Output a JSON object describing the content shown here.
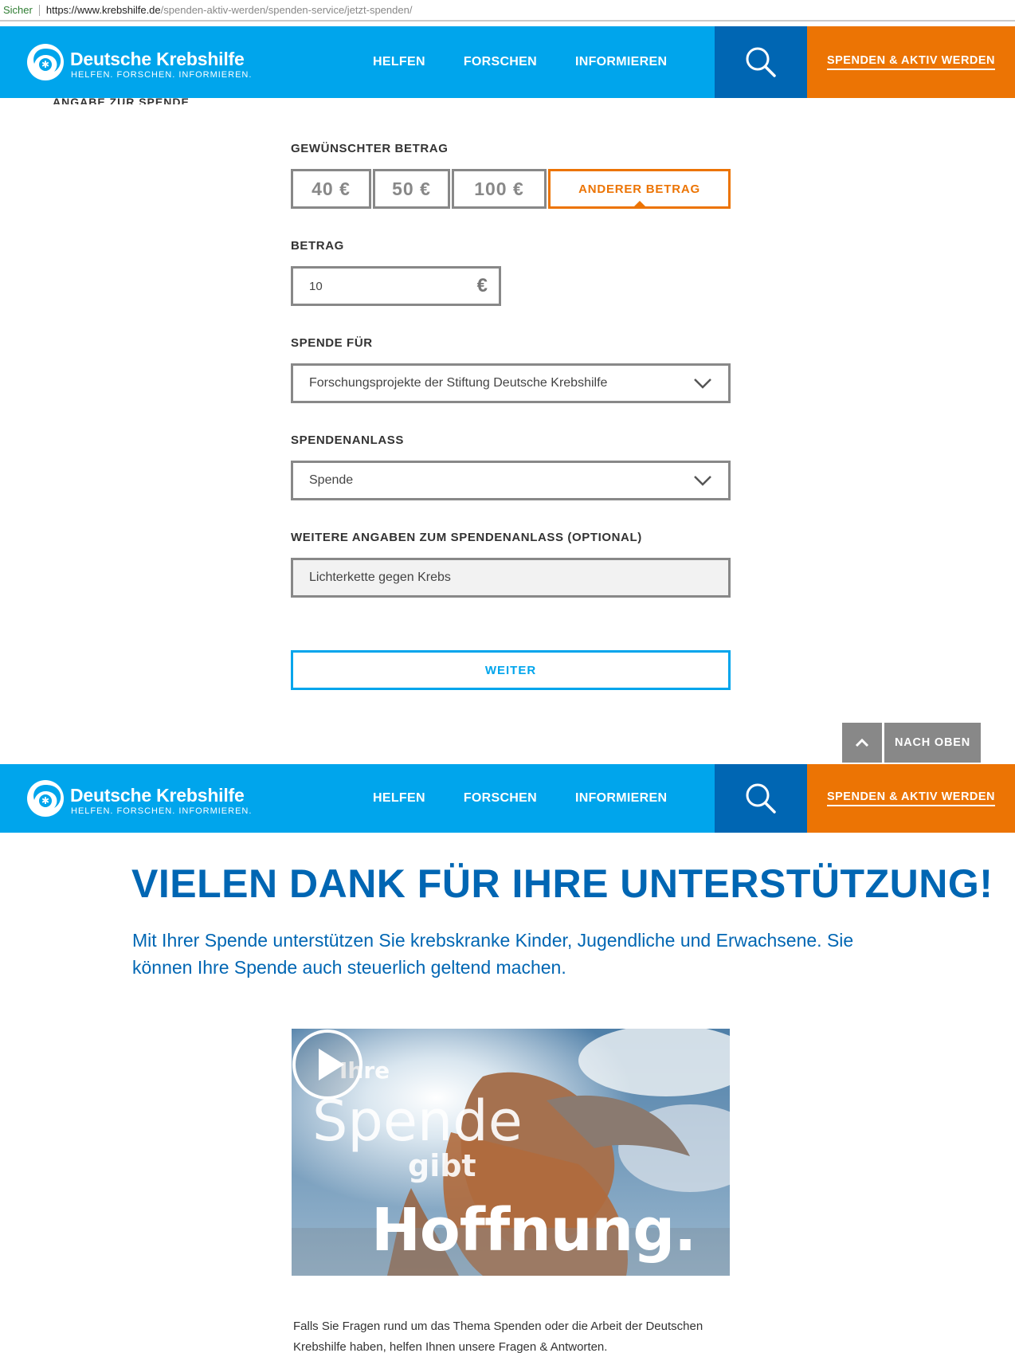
{
  "browser": {
    "secure_label": "Sicher",
    "url_host": "https://www.krebshilfe.de",
    "url_path": "/spenden-aktiv-werden/spenden-service/jetzt-spenden/"
  },
  "header": {
    "logo_name": "Deutsche Krebshilfe",
    "logo_tagline": "HELFEN. FORSCHEN. INFORMIEREN.",
    "nav": [
      "HELFEN",
      "FORSCHEN",
      "INFORMIEREN"
    ],
    "cta": "SPENDEN & AKTIV WERDEN",
    "colors": {
      "header": "#00a5ec",
      "search": "#0066b3",
      "cta": "#ec7404"
    }
  },
  "form": {
    "section_heading": "ANGABE ZUR SPENDE",
    "amount_label": "GEWÜNSCHTER BETRAG",
    "amounts": [
      "40 €",
      "50 €",
      "100 €",
      "ANDERER BETRAG"
    ],
    "selected_amount": "ANDERER BETRAG",
    "betrag_label": "BETRAG",
    "betrag_value": "10",
    "currency": "€",
    "purpose_label": "SPENDE FÜR",
    "purpose_value": "Forschungsprojekte der Stiftung Deutsche Krebshilfe",
    "occasion_label": "SPENDENANLASS",
    "occasion_value": "Spende",
    "extra_label": "WEITERE ANGABEN ZUM SPENDENANLASS (OPTIONAL)",
    "extra_value": "Lichterkette gegen Krebs",
    "submit": "WEITER"
  },
  "back_to_top": "NACH OBEN",
  "thanks": {
    "title": "VIELEN DANK FÜR IHRE UNTERSTÜTZUNG!",
    "text": "Mit Ihrer Spende unterstützen Sie krebskranke Kinder, Jugendliche und Erwachsene. Sie können Ihre Spende auch steuerlich geltend machen."
  },
  "video": {
    "line1": "Ihre",
    "line2": "Spende",
    "line3": "gibt",
    "line4": "Hoffnung."
  },
  "faq_text": "Falls Sie Fragen rund um das Thema Spenden oder die Arbeit der Deutschen Krebshilfe haben, helfen Ihnen unsere Fragen & Antworten."
}
